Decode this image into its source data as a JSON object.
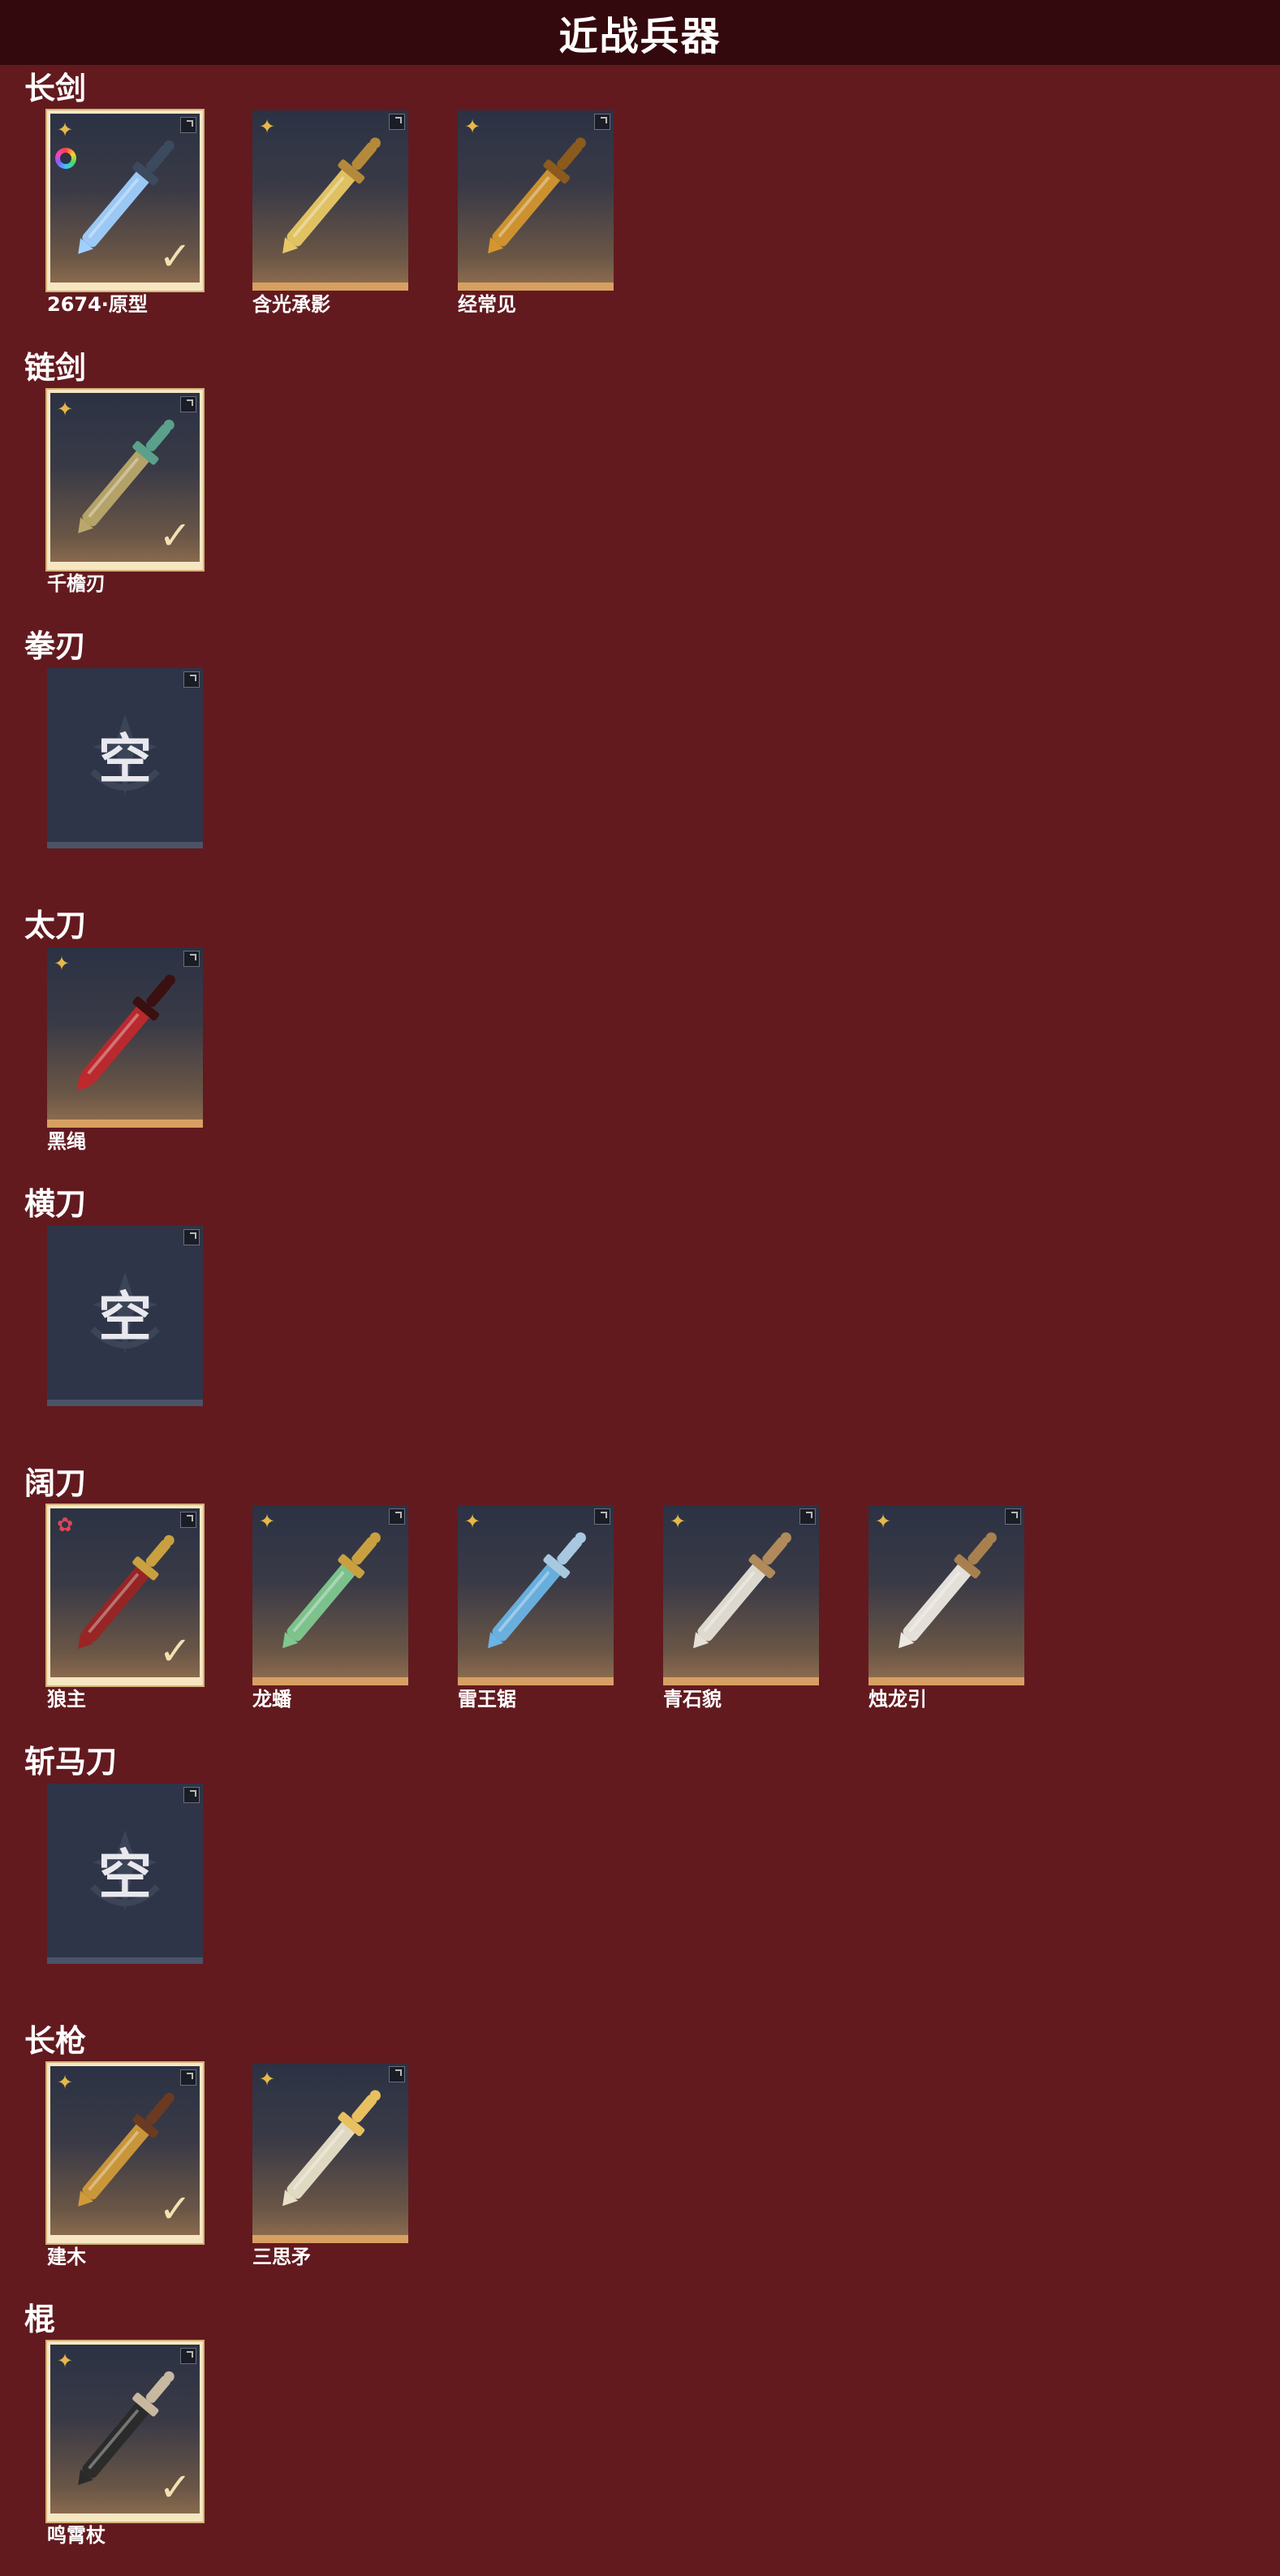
{
  "header": {
    "title": "近战兵器"
  },
  "empty_text": "空",
  "colors": {
    "background": "#621a1f",
    "header": "#34090d",
    "rarity_gold": "#e6b84a",
    "rarity_red": "#e0455a"
  },
  "sections": [
    {
      "title": "长剑",
      "items": [
        {
          "name": "2674·原型",
          "rarity": "gold-star",
          "selected": true,
          "dye_ring": true,
          "blade": "#9fd0ff",
          "hilt": "#3c4a5e"
        },
        {
          "name": "含光承影",
          "rarity": "gold-star",
          "selected": false,
          "dye_ring": false,
          "blade": "#e8c864",
          "hilt": "#b48a3a"
        },
        {
          "name": "经常见",
          "rarity": "gold-star",
          "selected": false,
          "dye_ring": false,
          "blade": "#d4962e",
          "hilt": "#8a5a1e"
        }
      ]
    },
    {
      "title": "链剑",
      "items": [
        {
          "name": "千檐刃",
          "rarity": "gold-star",
          "selected": true,
          "dye_ring": false,
          "blade": "#b9a86a",
          "hilt": "#5aa08a"
        }
      ]
    },
    {
      "title": "拳刃",
      "items": [
        {
          "empty": true
        }
      ]
    },
    {
      "title": "太刀",
      "items": [
        {
          "name": "黑绳",
          "rarity": "gold-star",
          "selected": false,
          "dye_ring": false,
          "blade": "#c0282c",
          "hilt": "#3a1010"
        }
      ]
    },
    {
      "title": "横刀",
      "items": [
        {
          "empty": true
        }
      ]
    },
    {
      "title": "阔刀",
      "items": [
        {
          "name": "狼主",
          "rarity": "red-star",
          "selected": true,
          "dye_ring": false,
          "blade": "#9a2424",
          "hilt": "#c8a040"
        },
        {
          "name": "龙蟠",
          "rarity": "gold-star",
          "selected": false,
          "dye_ring": false,
          "blade": "#7fc890",
          "hilt": "#c8a040"
        },
        {
          "name": "雷王锯",
          "rarity": "gold-star",
          "selected": false,
          "dye_ring": false,
          "blade": "#6ab4e6",
          "hilt": "#a8c8e0"
        },
        {
          "name": "青石貌",
          "rarity": "gold-star",
          "selected": false,
          "dye_ring": false,
          "blade": "#e6e0d6",
          "hilt": "#b08a5a"
        },
        {
          "name": "烛龙引",
          "rarity": "gold-star",
          "selected": false,
          "dye_ring": false,
          "blade": "#ece8e2",
          "hilt": "#a88050"
        }
      ]
    },
    {
      "title": "斩马刀",
      "items": [
        {
          "empty": true
        }
      ]
    },
    {
      "title": "长枪",
      "items": [
        {
          "name": "建木",
          "rarity": "gold-star",
          "selected": true,
          "dye_ring": false,
          "blade": "#d09a3a",
          "hilt": "#6a3a22"
        },
        {
          "name": "三思矛",
          "rarity": "gold-star",
          "selected": false,
          "dye_ring": false,
          "blade": "#e8e0c8",
          "hilt": "#e8c060"
        }
      ]
    },
    {
      "title": "棍",
      "items": [
        {
          "name": "鸣霄杖",
          "rarity": "gold-star",
          "selected": true,
          "dye_ring": false,
          "blade": "#2a2a2a",
          "hilt": "#c8b8a0"
        }
      ]
    }
  ]
}
